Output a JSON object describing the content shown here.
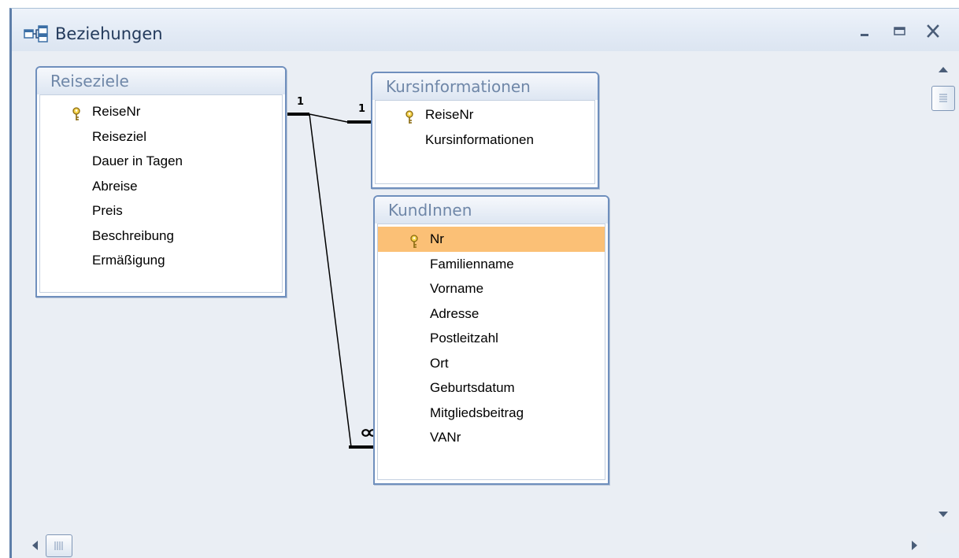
{
  "window": {
    "title": "Beziehungen",
    "icon": "relationships-icon",
    "controls": [
      "minimize-icon",
      "maximize-icon",
      "close-icon"
    ]
  },
  "tables": [
    {
      "name": "Reiseziele",
      "fields": [
        {
          "label": "ReiseNr",
          "primary_key": true
        },
        {
          "label": "Reiseziel",
          "primary_key": false
        },
        {
          "label": "Dauer in Tagen",
          "primary_key": false
        },
        {
          "label": "Abreise",
          "primary_key": false
        },
        {
          "label": "Preis",
          "primary_key": false
        },
        {
          "label": "Beschreibung",
          "primary_key": false
        },
        {
          "label": "Ermäßigung",
          "primary_key": false
        }
      ]
    },
    {
      "name": "Kursinformationen",
      "fields": [
        {
          "label": "ReiseNr",
          "primary_key": true
        },
        {
          "label": "Kursinformationen",
          "primary_key": false
        }
      ]
    },
    {
      "name": "KundInnen",
      "fields": [
        {
          "label": "Nr",
          "primary_key": true,
          "selected": true
        },
        {
          "label": "Familienname",
          "primary_key": false
        },
        {
          "label": "Vorname",
          "primary_key": false
        },
        {
          "label": "Adresse",
          "primary_key": false
        },
        {
          "label": "Postleitzahl",
          "primary_key": false
        },
        {
          "label": "Ort",
          "primary_key": false
        },
        {
          "label": "Geburtsdatum",
          "primary_key": false
        },
        {
          "label": "Mitgliedsbeitrag",
          "primary_key": false
        },
        {
          "label": "VANr",
          "primary_key": false
        }
      ]
    }
  ],
  "relationships": [
    {
      "from": "Reiseziele.ReiseNr",
      "to": "Kursinformationen.ReiseNr",
      "from_cardinality": "1",
      "to_cardinality": "1"
    },
    {
      "from": "Reiseziele.ReiseNr",
      "to": "KundInnen.VANr",
      "from_cardinality": "1",
      "to_cardinality": "∞"
    }
  ],
  "colors": {
    "canvas": "#eaeef4",
    "table_border": "#6f8fbd",
    "selected_row": "#fbc076",
    "title_text": "#233a5c"
  }
}
